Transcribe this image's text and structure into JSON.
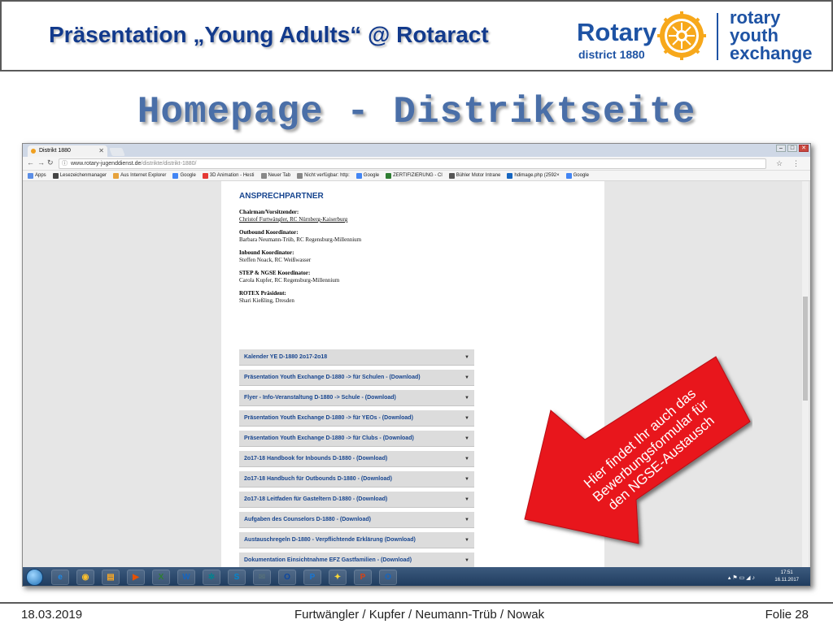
{
  "header": {
    "title": "Präsentation „Young Adults“ @ Rotaract",
    "logo_rotary": "Rotary",
    "logo_district": "district 1880",
    "logo_rye_line1": "rotary",
    "logo_rye_line2": "youth",
    "logo_rye_line3": "exchange"
  },
  "heading": "Homepage - Distriktseite",
  "browser": {
    "tab_title": "Distrikt 1880",
    "url_host": "www.rotary-jugenddienst.de",
    "url_path": "/distrikte/distrikt-1880/",
    "bookmarks": [
      "Apps",
      "Lesezeichenmanager",
      "Aus Internet Explorer",
      "Google",
      "3D Animation - Hesti",
      "Neuer Tab",
      "Nicht verfügbar: http:",
      "Google",
      "ZERTIFIZIERUNG - Cl",
      "Bühler Motor Intrane",
      "hdimage.php (2592×",
      "Google"
    ],
    "icons": [
      "info-icon",
      "star-icon",
      "menu-icon",
      "back-icon",
      "forward-icon",
      "reload-icon"
    ]
  },
  "page": {
    "section_heading": "ANSPRECHPARTNER",
    "contacts": [
      {
        "role": "Chairman/Vorsitzender:",
        "person": "Christof Furtwängler, RC Nürnberg-Kaiserburg"
      },
      {
        "role": "Outbound Koordinator:",
        "person": "Barbara Neumann-Trüb, RC Regensburg-Millennium"
      },
      {
        "role": "Inbound Koordinator:",
        "person": "Steffen Noack, RC Weißwasser"
      },
      {
        "role": "STEP & NGSE Koordinator:",
        "person": "Carola Kupfer, RC Regensburg-Millennium"
      },
      {
        "role": "ROTEX Präsident:",
        "person": "Shari Kießling, Dresden"
      }
    ],
    "documents": [
      "Kalender YE D-1880 2o17-2o18",
      "Präsentation Youth Exchange D-1880 -> für Schulen - (Download)",
      "Flyer - Info-Veranstaltung D-1880 -> Schule - (Download)",
      "Präsentation Youth Exchange D-1880 -> für YEOs - (Download)",
      "Präsentation Youth Exchange D-1880 -> für Clubs - (Download)",
      "2o17-18 Handbook for Inbounds D-1880 - (Download)",
      "2o17-18 Handbuch für Outbounds D-1880 - (Download)",
      "2o17-18 Leitfaden für Gasteltern D-1880 - (Download)",
      "Aufgaben des Counselors D-1880 - (Download)",
      "Austauschregeln D-1880 - Verpflichtende Erklärung (Download)",
      "Dokumentation Einsichtnahme EFZ Gastfamilien - (Download)"
    ]
  },
  "taskbar": {
    "apps": [
      "IE",
      "Chrome",
      "Explorer",
      "Media",
      "Excel",
      "Word",
      "Settings",
      "Skype",
      "Mail",
      "Outlook",
      "PSE",
      "Tool",
      "PowerPoint",
      "Outlook"
    ],
    "time": "17:51",
    "date": "16.11.2017"
  },
  "callout": {
    "line1": "Hier findet Ihr auch das",
    "line2": "Bewerbungsformular für",
    "line3": "den NGSE-Austausch",
    "color": "#e8141a"
  },
  "footer": {
    "date": "18.03.2019",
    "authors": "Furtwängler / Kupfer / Neumann-Trüb / Nowak",
    "slide": "Folie 28"
  },
  "colors": {
    "title_blue": "#123a8c",
    "rotary_blue": "#1e53a4",
    "rotary_gold": "#f7a81b",
    "heading_blue": "#4a6fa8",
    "link_blue": "#17458f"
  }
}
